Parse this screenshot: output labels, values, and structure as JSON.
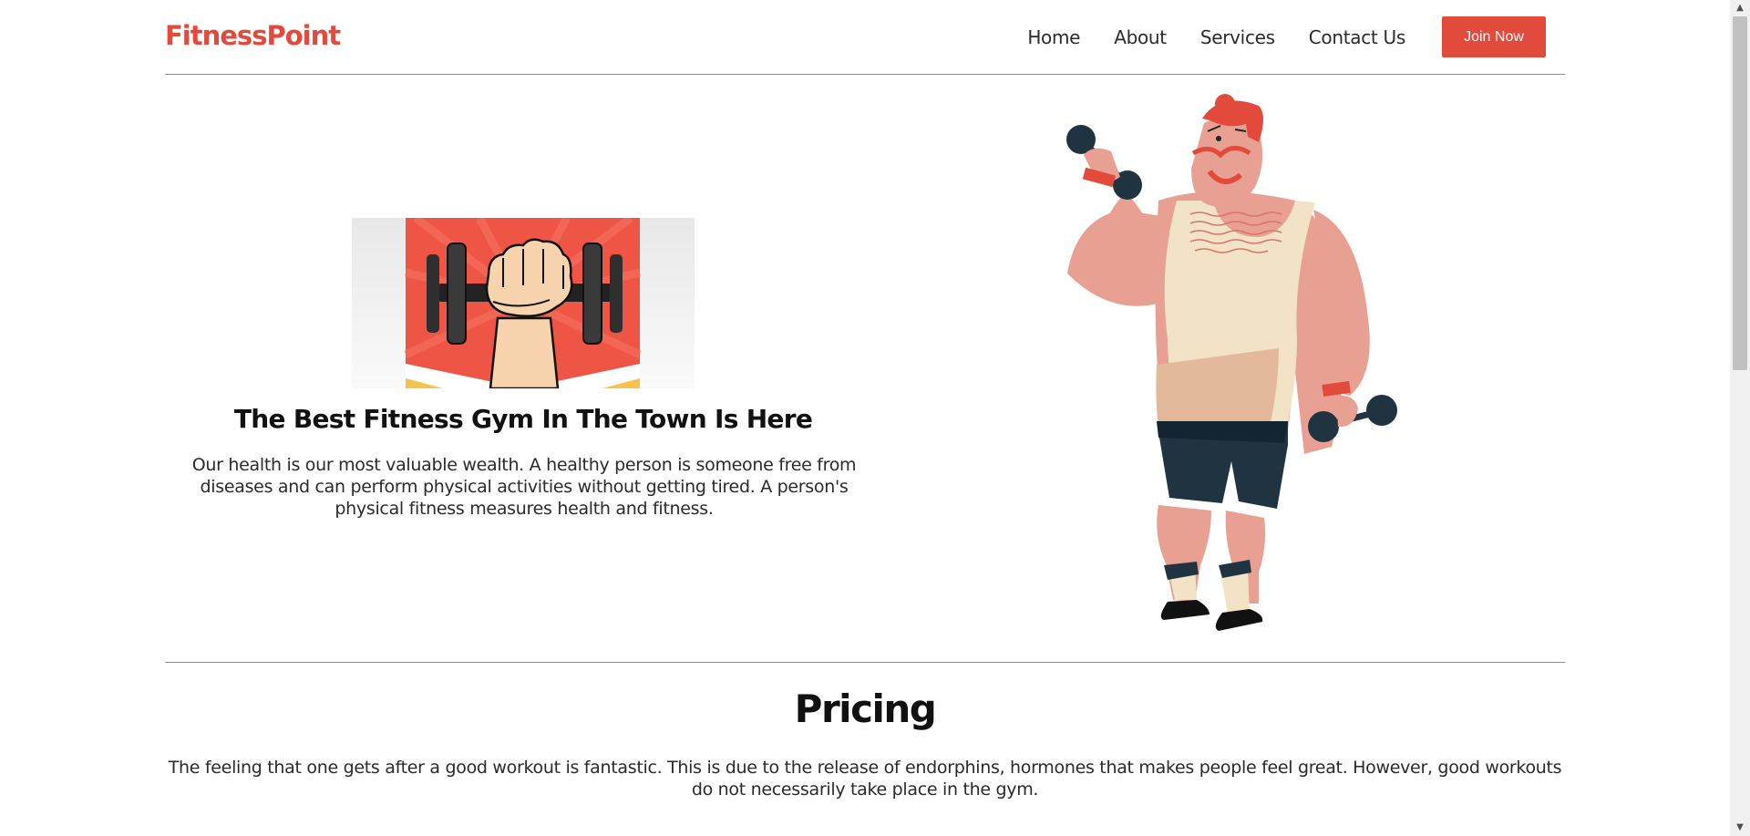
{
  "header": {
    "logo": "FitnessPoint",
    "nav": [
      "Home",
      "About",
      "Services",
      "Contact Us"
    ],
    "cta": "Join Now"
  },
  "hero": {
    "title": "The Best Fitness Gym In The Town Is Here",
    "text": "Our health is our most valuable wealth. A healthy person is someone free from diseases and can perform physical activities without getting tired. A person's physical fitness measures health and fitness."
  },
  "pricing": {
    "title": "Pricing",
    "text": "The feeling that one gets after a good workout is fantastic. This is due to the release of endorphins, hormones that makes people feel great. However, good workouts do not necessarily take place in the gym."
  },
  "colors": {
    "brand": "#e24a3b",
    "divider": "#8d8d8d"
  },
  "icons": {
    "scroll_up": "scroll-up-arrow-icon",
    "scroll_down": "scroll-down-arrow-icon"
  }
}
